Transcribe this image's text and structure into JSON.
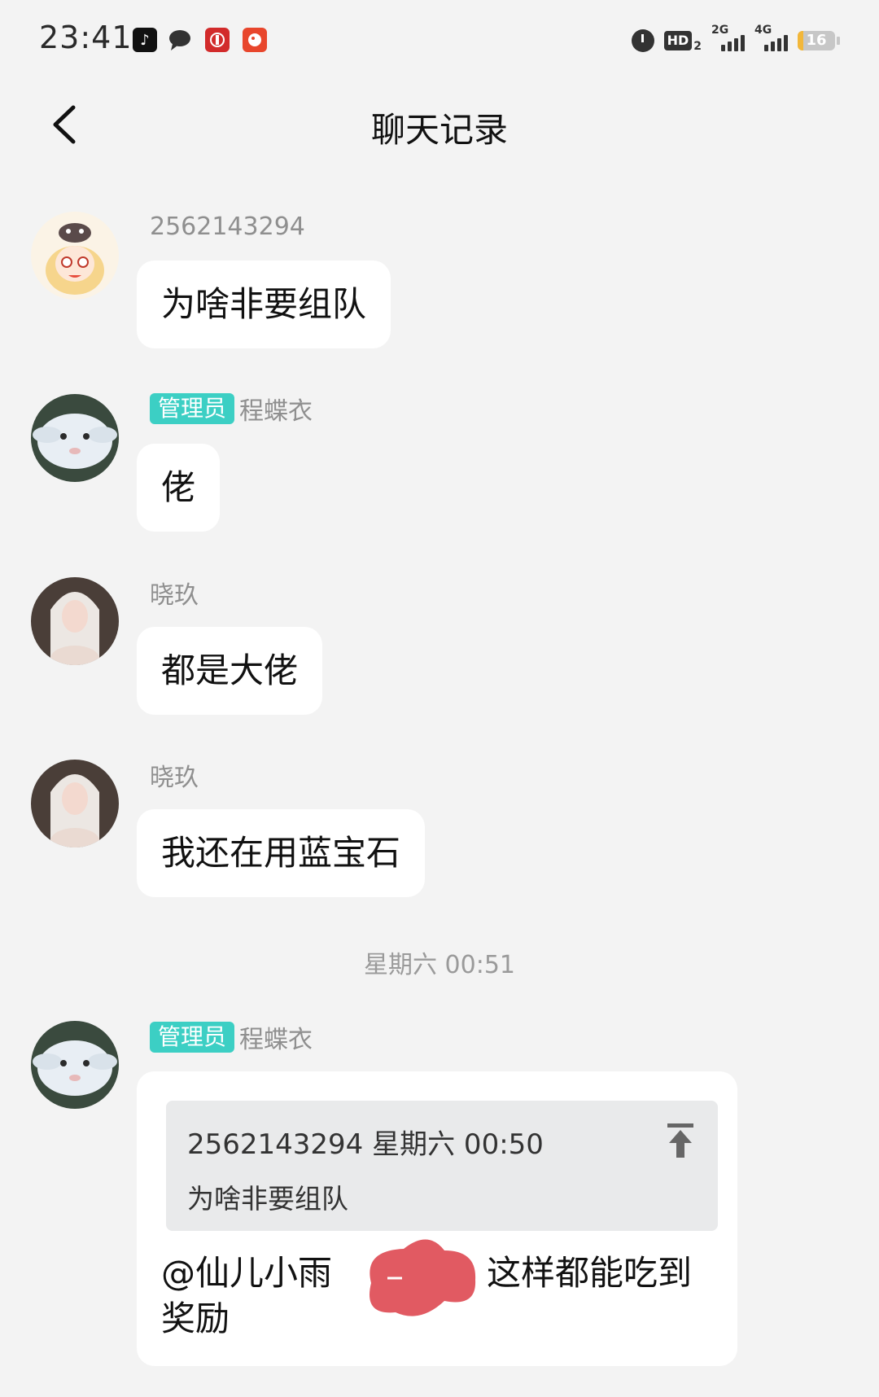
{
  "status_bar": {
    "time": "23:41",
    "icons": [
      "tiktok-icon",
      "message-icon",
      "bank-app-icon",
      "game-app-icon"
    ],
    "hd_label": "HD",
    "hd_sub": "2",
    "network_1": "2G",
    "network_2": "4G",
    "battery_level": "16",
    "battery_fraction": 0.16
  },
  "nav": {
    "title": "聊天记录"
  },
  "messages": [
    {
      "sender": "2562143294",
      "text": "为啥非要组队"
    },
    {
      "badge": "管理员",
      "sender": "程蝶衣",
      "text": "佬"
    },
    {
      "sender": "晓玖",
      "text": "都是大佬"
    },
    {
      "sender": "晓玖",
      "text": "我还在用蓝宝石"
    }
  ],
  "time_divider": "星期六 00:51",
  "reply_message": {
    "badge": "管理员",
    "sender": "程蝶衣",
    "quote_header": "2562143294 星期六 00:50",
    "quote_text": "为啥非要组队",
    "mention": "@仙儿小雨",
    "text_after": "这样都能吃到奖励"
  },
  "colors": {
    "background": "#f3f3f3",
    "bubble": "#ffffff",
    "admin_badge": "#3ccfc4",
    "quote_card": "#e9eaeb",
    "redaction": "#e15a62"
  }
}
